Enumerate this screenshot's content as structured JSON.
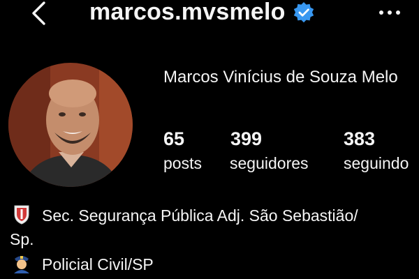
{
  "header": {
    "username": "marcos.mvsmelo",
    "back_icon": "chevron-left-icon",
    "verified_icon": "verified-badge-icon",
    "more_icon": "ellipsis-horizontal-icon"
  },
  "profile": {
    "full_name": "Marcos Vinícius de Souza Melo",
    "avatar_icon": "profile-photo"
  },
  "stats": [
    {
      "value": "65",
      "label": "posts"
    },
    {
      "value": "399",
      "label": "seguidores"
    },
    {
      "value": "383",
      "label": "seguindo"
    }
  ],
  "bio": {
    "line1_icon": "shield-badge-icon",
    "line1_text": "Sec. Segurança Pública Adj. São Sebastião/",
    "line1_cont": "Sp.",
    "line2_icon": "police-officer-icon",
    "line2_text": "Policial Civil/SP"
  },
  "colors": {
    "background": "#000000",
    "text": "#f5f5f5",
    "verified": "#3897f0"
  }
}
